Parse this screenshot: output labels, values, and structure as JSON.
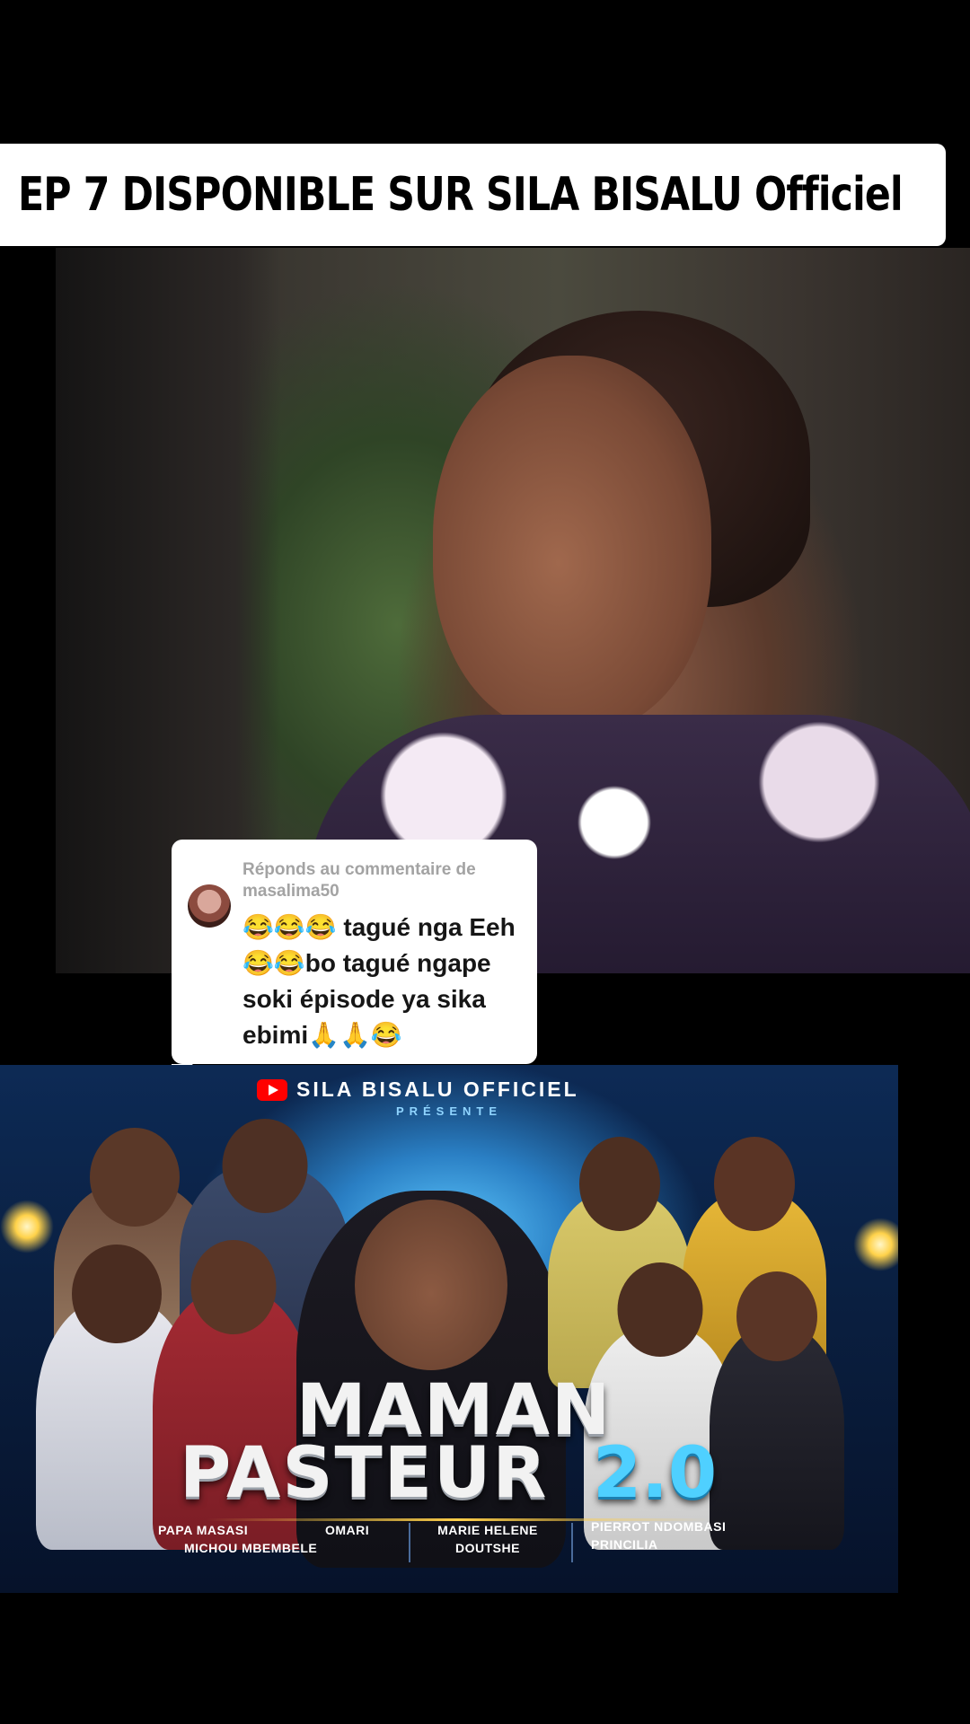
{
  "banner": {
    "text": "EP 7 DISPONIBLE SUR SILA BISALU Officiel"
  },
  "comment": {
    "reply_label": "Réponds au commentaire de",
    "username": "masalima50",
    "text": "😂😂😂 tagué nga Eeh😂😂bo tagué ngape soki épisode ya sika ebimi🙏🙏😂"
  },
  "poster": {
    "channel": "SILA BISALU OFFICIEL",
    "presents": "PRÉSENTE",
    "title_line1": "MAMAN",
    "title_line2": "PASTEUR",
    "title_version": "2.0",
    "cast": {
      "col1_a": "PAPA MASASI",
      "col1_b": "MICHOU MBEMBELE",
      "col2": "OMARI",
      "col3_a": "MARIE HELENE",
      "col3_b": "DOUTSHE",
      "col4_a": "PIERROT NDOMBASI",
      "col4_b": "PRINCILIA"
    }
  },
  "colors": {
    "banner_bg": "#ffffff",
    "title_accent": "#4fd0ff",
    "youtube_red": "#ff0000"
  }
}
